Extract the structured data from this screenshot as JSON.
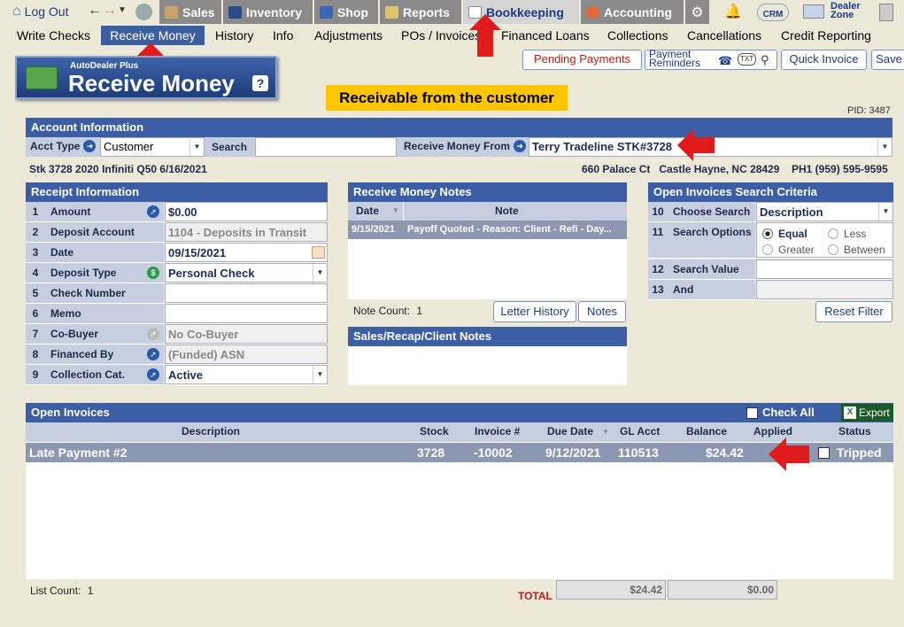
{
  "topnav": {
    "logout": "Log Out",
    "items": [
      {
        "label": "Sales"
      },
      {
        "label": "Inventory"
      },
      {
        "label": "Shop"
      },
      {
        "label": "Reports"
      },
      {
        "label": "Bookkeeping"
      },
      {
        "label": "Accounting"
      }
    ],
    "crm": "CRM",
    "dealer_zone": "Dealer Zone"
  },
  "subnav": [
    "Write Checks",
    "Receive Money",
    "History",
    "Info",
    "Adjustments",
    "POs / Invoices",
    "Financed Loans",
    "Collections",
    "Cancellations",
    "Credit Reporting"
  ],
  "toolbar": {
    "pending": "Pending Payments",
    "payment_reminders": "Payment Reminders",
    "txt": "TXT",
    "quick_invoice": "Quick Invoice",
    "save": "Save"
  },
  "page": {
    "brand": "AutoDealer Plus",
    "title": "Receive Money",
    "help": "?",
    "banner": "Receivable from the customer",
    "pid": "PID: 3487"
  },
  "account": {
    "header": "Account Information",
    "acct_type_label": "Acct Type",
    "acct_type": "Customer",
    "search_label": "Search",
    "search_value": "",
    "receive_from_label": "Receive Money From",
    "receive_from": "Terry Tradeline STK#3728",
    "vehicle": "Stk 3728 2020 Infiniti Q50 6/16/2021",
    "address": "660 Palace Ct   Castle Hayne, NC 28429",
    "phone": "PH1 (959) 595-9595"
  },
  "receipt": {
    "header": "Receipt Information",
    "rows": [
      {
        "num": "1",
        "label": "Amount",
        "value": "$0.00"
      },
      {
        "num": "2",
        "label": "Deposit Account",
        "value": "1104 - Deposits in Transit"
      },
      {
        "num": "3",
        "label": "Date",
        "value": "09/15/2021"
      },
      {
        "num": "4",
        "label": "Deposit Type",
        "value": "Personal Check"
      },
      {
        "num": "5",
        "label": "Check Number",
        "value": ""
      },
      {
        "num": "6",
        "label": "Memo",
        "value": ""
      },
      {
        "num": "7",
        "label": "Co-Buyer",
        "value": "No Co-Buyer"
      },
      {
        "num": "8",
        "label": "Financed By",
        "value": "(Funded) ASN"
      },
      {
        "num": "9",
        "label": "Collection Cat.",
        "value": "Active"
      }
    ]
  },
  "notes": {
    "header": "Receive Money Notes",
    "col_date": "Date",
    "col_note": "Note",
    "rows": [
      {
        "date": "9/15/2021",
        "note": "Payoff Quoted - Reason: Client - Refi - Day..."
      }
    ],
    "count_label": "Note Count:",
    "count": "1",
    "letter_history": "Letter History",
    "notes_btn": "Notes",
    "sales_header": "Sales/Recap/Client Notes"
  },
  "criteria": {
    "header": "Open Invoices Search Criteria",
    "rows": [
      {
        "num": "10",
        "label": "Choose Search",
        "value": "Description"
      },
      {
        "num": "11",
        "label": "Search Options"
      },
      {
        "num": "12",
        "label": "Search Value",
        "value": ""
      },
      {
        "num": "13",
        "label": "And",
        "value": ""
      }
    ],
    "options": [
      "Equal",
      "Less",
      "Greater",
      "Between"
    ],
    "reset": "Reset Filter"
  },
  "invoices": {
    "header": "Open Invoices",
    "check_all": "Check All",
    "export": "Export",
    "columns": [
      "Description",
      "Stock",
      "Invoice #",
      "Due Date",
      "GL Acct",
      "Balance",
      "Applied",
      "Status"
    ],
    "rows": [
      {
        "description": "Late Payment #2",
        "stock": "3728",
        "invoice": "-10002",
        "due": "9/12/2021",
        "gl": "110513",
        "balance": "$24.42",
        "applied": "",
        "status": "Tripped"
      }
    ],
    "list_count_label": "List Count:",
    "list_count": "1",
    "total_label": "TOTAL",
    "total_balance": "$24.42",
    "total_applied": "$0.00"
  }
}
